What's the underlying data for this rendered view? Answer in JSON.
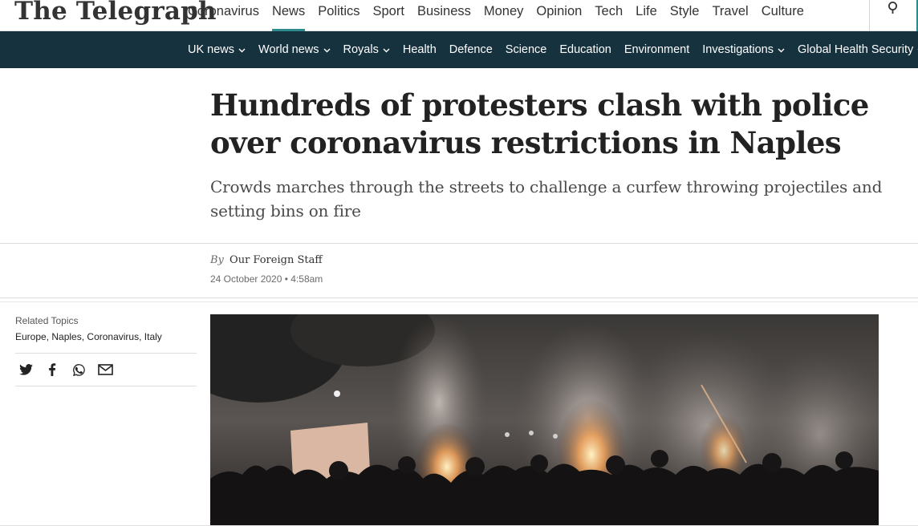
{
  "site": {
    "logo_text": "The Telegraph"
  },
  "top_nav": {
    "items": [
      "Coronavirus",
      "News",
      "Politics",
      "Sport",
      "Business",
      "Money",
      "Opinion",
      "Tech",
      "Life",
      "Style",
      "Travel",
      "Culture"
    ],
    "active": "News",
    "search_icon": "search-icon"
  },
  "sub_nav": {
    "items": [
      {
        "label": "UK news",
        "dropdown": true
      },
      {
        "label": "World news",
        "dropdown": true
      },
      {
        "label": "Royals",
        "dropdown": true
      },
      {
        "label": "Health",
        "dropdown": false
      },
      {
        "label": "Defence",
        "dropdown": false
      },
      {
        "label": "Science",
        "dropdown": false
      },
      {
        "label": "Education",
        "dropdown": false
      },
      {
        "label": "Environment",
        "dropdown": false
      },
      {
        "label": "Investigations",
        "dropdown": true
      },
      {
        "label": "Global Health Security",
        "dropdown": true
      }
    ]
  },
  "article": {
    "headline": "Hundreds of protesters clash with police over coronavirus restrictions in Naples",
    "standfirst": "Crowds marches through the streets to challenge a curfew throwing projectiles and setting bins on fire",
    "byline_prefix": "By",
    "author": "Our Foreign Staff",
    "date": "24 October 2020 • 4:58am"
  },
  "sidebar": {
    "related_label": "Related Topics",
    "topics": [
      "Europe",
      "Naples",
      "Coronavirus",
      "Italy"
    ],
    "share_icons": [
      "twitter-icon",
      "facebook-icon",
      "whatsapp-icon",
      "email-icon"
    ]
  },
  "colors": {
    "subnav_bg": "#16323f",
    "active_underline": "#2d8a8f",
    "headline": "#222222"
  }
}
